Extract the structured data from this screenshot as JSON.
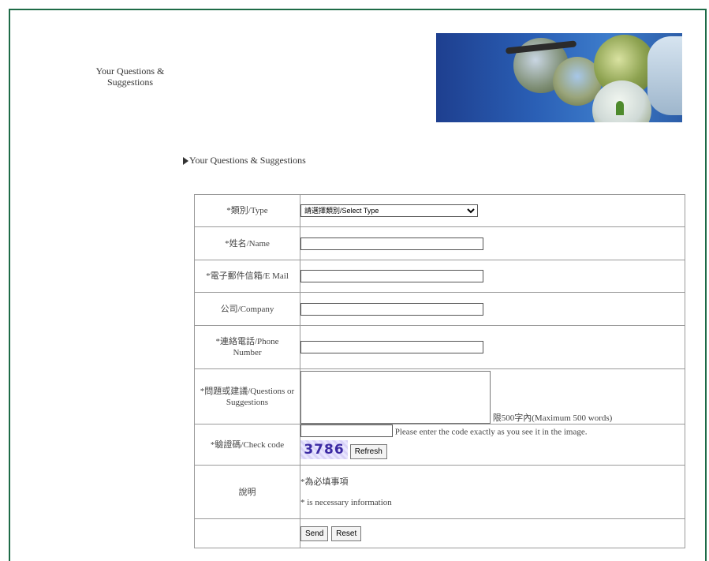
{
  "side_title": "Your Questions & Suggestions",
  "section_heading": "Your Questions & Suggestions",
  "form": {
    "type_label": "*類別/Type",
    "type_selected": "請選擇類別/Select Type",
    "name_label": "*姓名/Name",
    "email_label": "*電子郵件信箱/E Mail",
    "company_label": "公司/Company",
    "phone_label": "*連絡電話/Phone Number",
    "questions_label": "*問題或建議/Questions or Suggestions",
    "questions_limit": "限500字內(Maximum 500 words)",
    "check_label": "*驗證碼/Check code",
    "check_hint": "Please enter the code exactly as you see it in the image.",
    "captcha_text": "3786",
    "refresh_label": "Refresh",
    "note_label": "說明",
    "note_line1": "*為必填事項",
    "note_line2": "* is necessary information",
    "send_label": "Send",
    "reset_label": "Reset"
  }
}
